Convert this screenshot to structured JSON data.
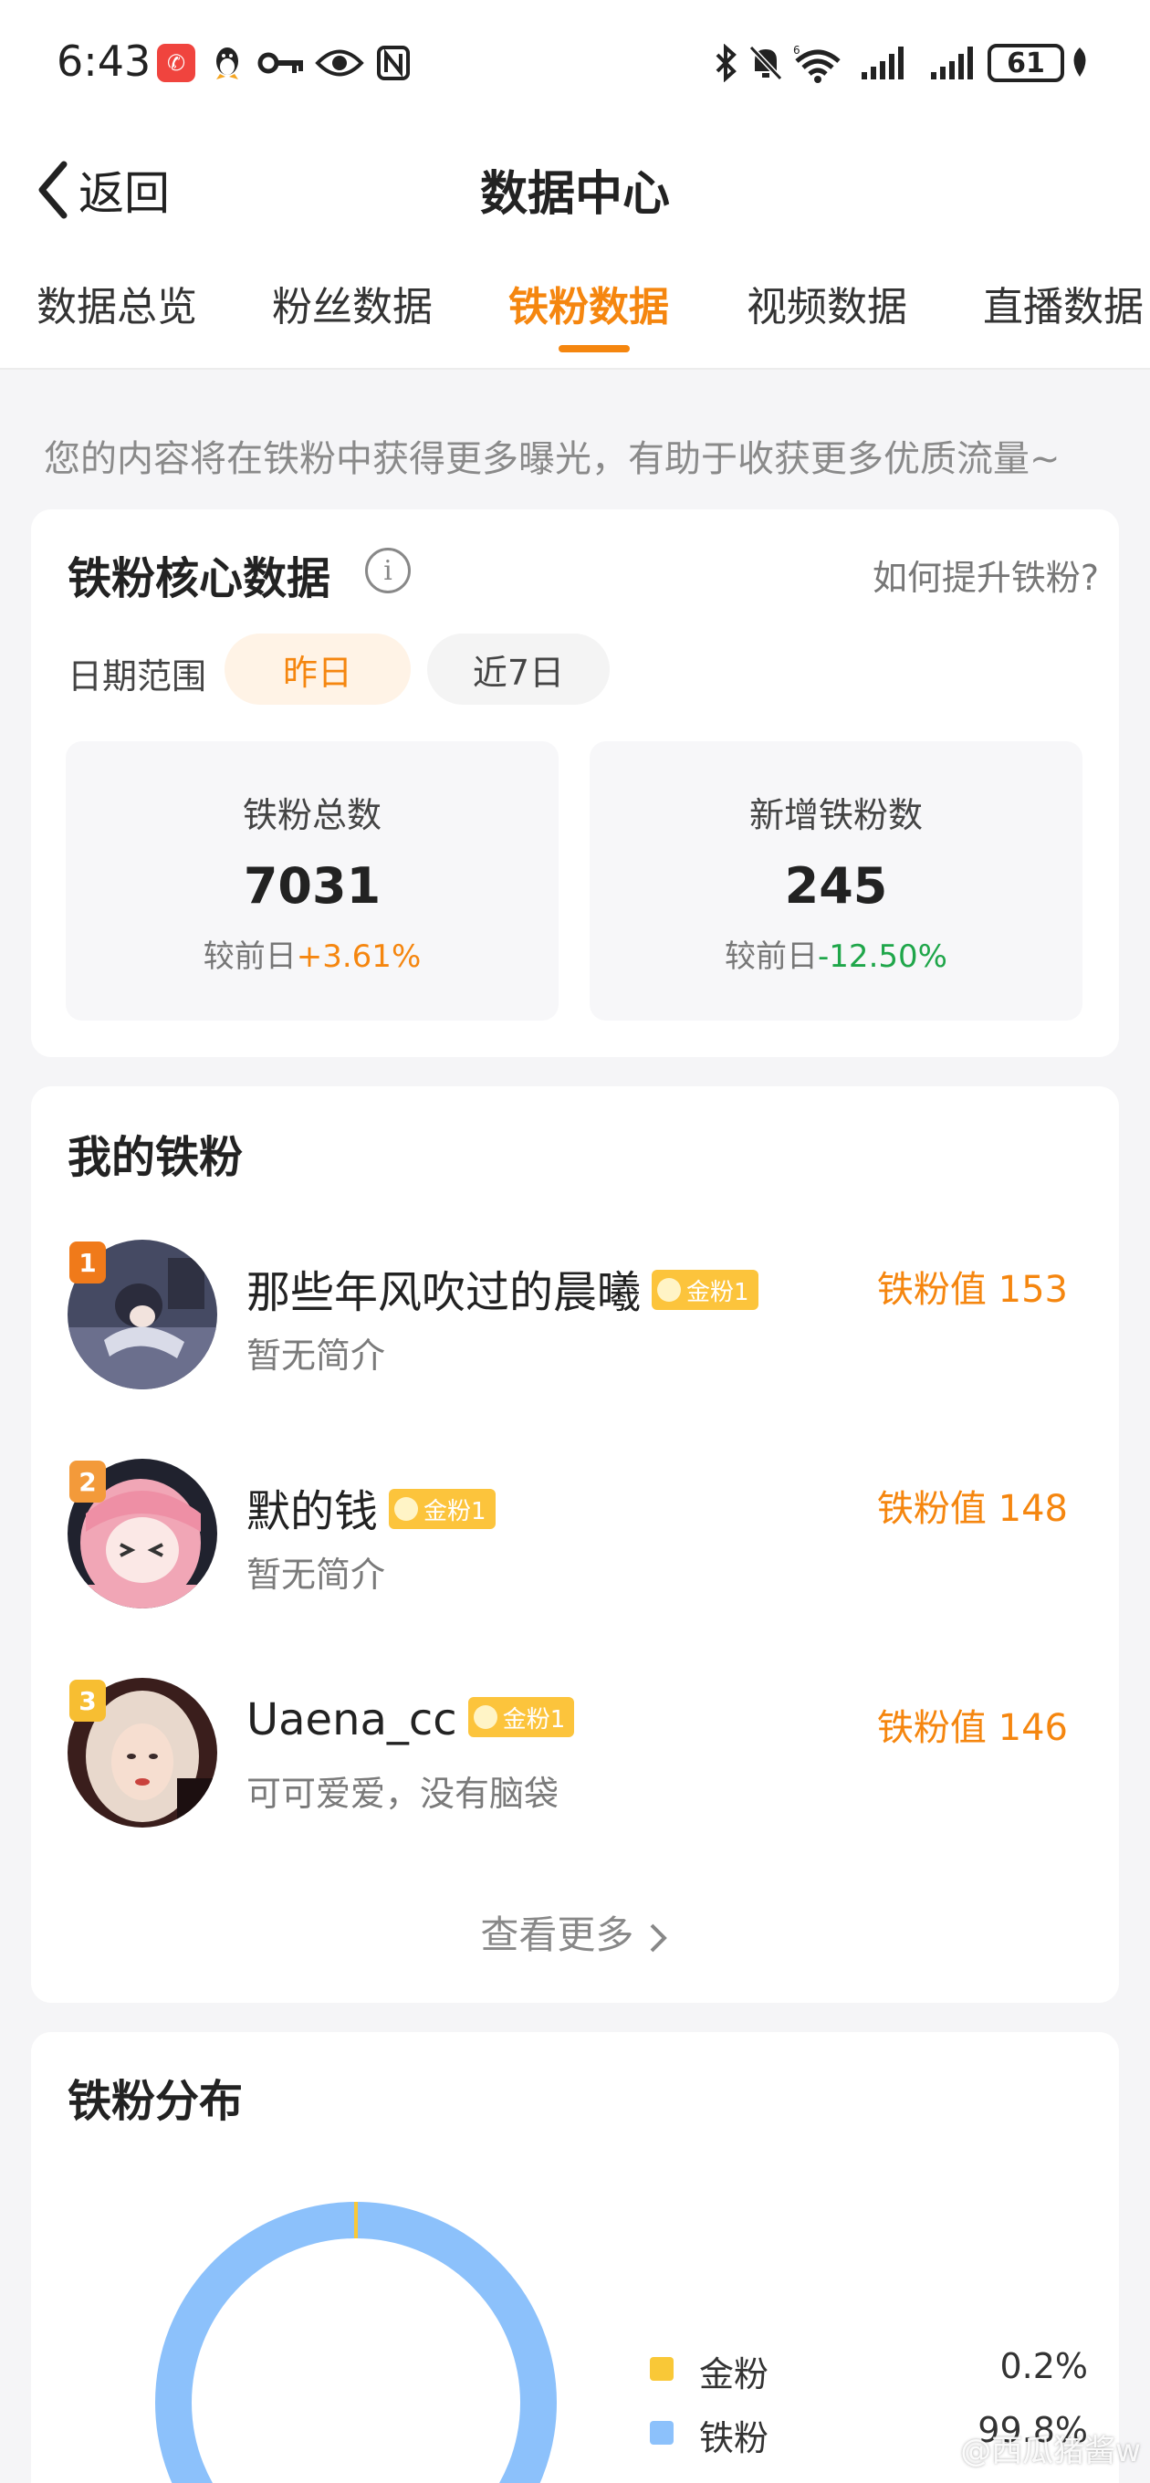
{
  "status_bar": {
    "time": "6:43",
    "battery": "61",
    "network": "6"
  },
  "nav": {
    "back_label": "返回",
    "title": "数据中心"
  },
  "tabs": [
    {
      "label": "数据总览",
      "active": false
    },
    {
      "label": "粉丝数据",
      "active": false
    },
    {
      "label": "铁粉数据",
      "active": true
    },
    {
      "label": "视频数据",
      "active": false
    },
    {
      "label": "直播数据",
      "active": false
    }
  ],
  "hint": "您的内容将在铁粉中获得更多曝光，有助于收获更多优质流量~",
  "core": {
    "title": "铁粉核心数据",
    "how_link": "如何提升铁粉?",
    "range_label": "日期范围",
    "ranges": [
      "昨日",
      "近7日"
    ],
    "stats": [
      {
        "label": "铁粉总数",
        "value": "7031",
        "compare_prefix": "较前日",
        "change": "+3.61%"
      },
      {
        "label": "新增铁粉数",
        "value": "245",
        "compare_prefix": "较前日",
        "change": "-12.50%"
      }
    ]
  },
  "fans": {
    "title": "我的铁粉",
    "badge_label": "金粉1",
    "value_prefix": "铁粉值",
    "items": [
      {
        "rank": "1",
        "name": "那些年风吹过的晨曦",
        "bio": "暂无简介",
        "value": "153"
      },
      {
        "rank": "2",
        "name": "默的钱",
        "bio": "暂无简介",
        "value": "148"
      },
      {
        "rank": "3",
        "name": "Uaena_cc",
        "bio": "可可爱爱，没有脑袋",
        "value": "146"
      }
    ],
    "see_more": "查看更多"
  },
  "distribution": {
    "title": "铁粉分布",
    "items": [
      {
        "name": "金粉",
        "value": "0.2%",
        "color": "#f9c837"
      },
      {
        "name": "铁粉",
        "value": "99.8%",
        "color": "#8cc1fb"
      }
    ]
  },
  "colors": {
    "accent": "#f5860f",
    "up": "#f5860f",
    "down": "#1fa64a",
    "rank_1": "#f07a1a",
    "rank_2": "#f39a3a",
    "rank_3": "#f7be32"
  },
  "watermark": "@西瓜猪酱w"
}
